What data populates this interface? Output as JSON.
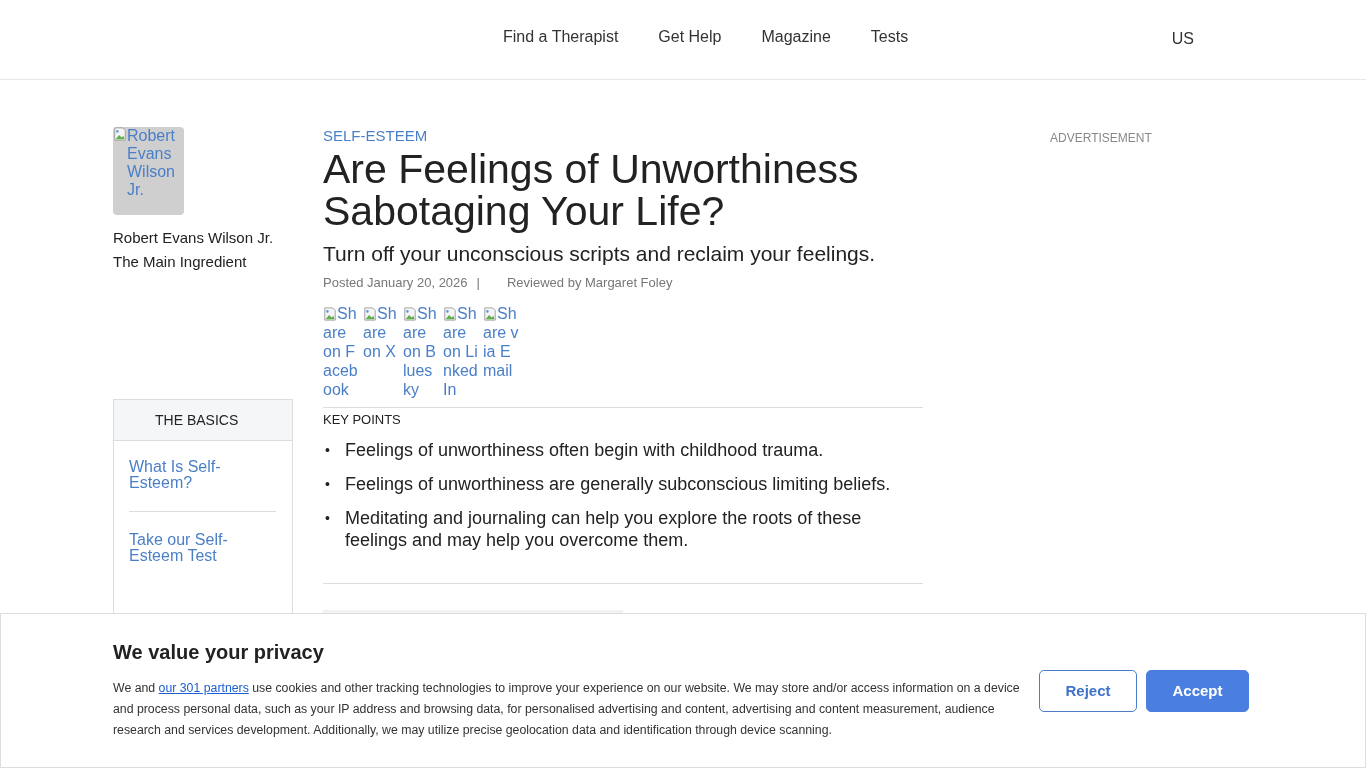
{
  "header": {
    "nav": [
      "Find a Therapist",
      "Get Help",
      "Magazine",
      "Tests"
    ],
    "region": "US"
  },
  "author": {
    "photo_alt": "Robert Evans Wilson Jr.",
    "name": "Robert Evans Wilson Jr.",
    "column": "The Main Ingredient"
  },
  "basics": {
    "title": "THE BASICS",
    "links": [
      "What Is Self-Esteem?",
      "Take our Self-Esteem Test"
    ]
  },
  "article": {
    "category": "SELF-ESTEEM",
    "title": "Are Feelings of Unworthiness Sabotaging Your Life?",
    "subtitle": "Turn off your unconscious scripts and reclaim your feelings.",
    "posted": "Posted January 20, 2026",
    "separator": "|",
    "reviewed": "Reviewed by Margaret Foley",
    "share": [
      "Share on Facebook",
      "Share on X",
      "Share on Bluesky",
      "Share on LinkedIn",
      "Share via Email"
    ],
    "key_points_title": "KEY POINTS",
    "bullet": "•",
    "key_points": [
      "Feelings of unworthiness often begin with childhood trauma.",
      "Feelings of unworthiness are generally subconscious limiting beliefs.",
      "Meditating and journaling can help you explore the roots of these feelings and may help you overcome them."
    ],
    "image": {
      "kind": "picture"
    }
  },
  "advertisement": "ADVERTISEMENT",
  "cookie_banner": {
    "title": "We value your privacy",
    "text_before": "We and ",
    "link": "our 301 partners",
    "text_after": " use cookies and other tracking technologies to improve your experience on our website. We may store and/or access information on a device and process personal data, such as your IP address and browsing data, for personalised advertising and content, advertising and content measurement, audience research and services development. Additionally, we may utilize precise geolocation data and identification through device scanning.",
    "buttons": [
      {
        "label": "Reject",
        "kind": "secondary"
      },
      {
        "label": "Accept",
        "kind": "primary"
      }
    ]
  }
}
